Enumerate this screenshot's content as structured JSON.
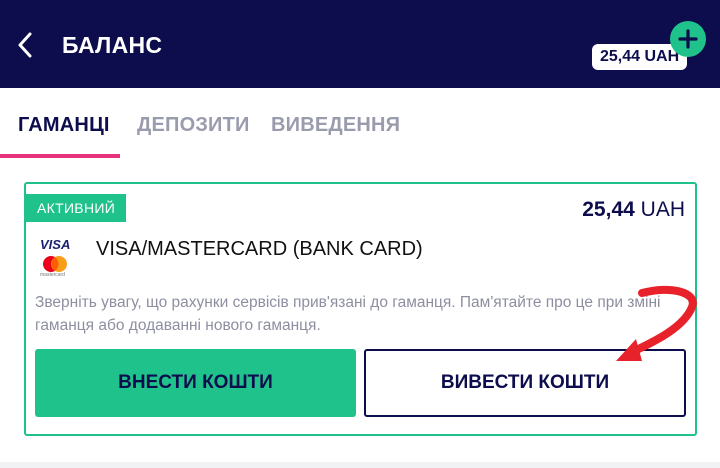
{
  "header": {
    "title": "БАЛАНС",
    "balance": "25,44 UAH",
    "colors": {
      "background": "#0d0d4d",
      "accent": "#1fc28a"
    }
  },
  "tabs": [
    {
      "label": "ГАМАНЦІ",
      "active": true
    },
    {
      "label": "ДЕПОЗИТИ",
      "active": false
    },
    {
      "label": "ВИВЕДЕННЯ",
      "active": false
    }
  ],
  "wallet": {
    "status_badge": "АКТИВНИЙ",
    "amount_value": "25,44",
    "amount_currency": "UAH",
    "logo": {
      "visa": "VISA",
      "mastercard": "mastercard"
    },
    "method_name": "VISA/MASTERCARD (BANK CARD)",
    "notice": "Зверніть увагу, що рахунки сервісів прив'язані до гаманця. Пам'ятайте про це при зміні гаманця або додаванні нового гаманця.",
    "deposit_button": "ВНЕСТИ КОШТИ",
    "withdraw_button": "ВИВЕСТИ КОШТИ"
  },
  "icons": {
    "back": "chevron-left-icon",
    "add": "plus-icon",
    "annotation": "red-arrow-annotation"
  },
  "colors": {
    "tab_indicator": "#e5327a",
    "annotation_arrow": "#e8222b",
    "muted_text": "#8d8fa0"
  }
}
